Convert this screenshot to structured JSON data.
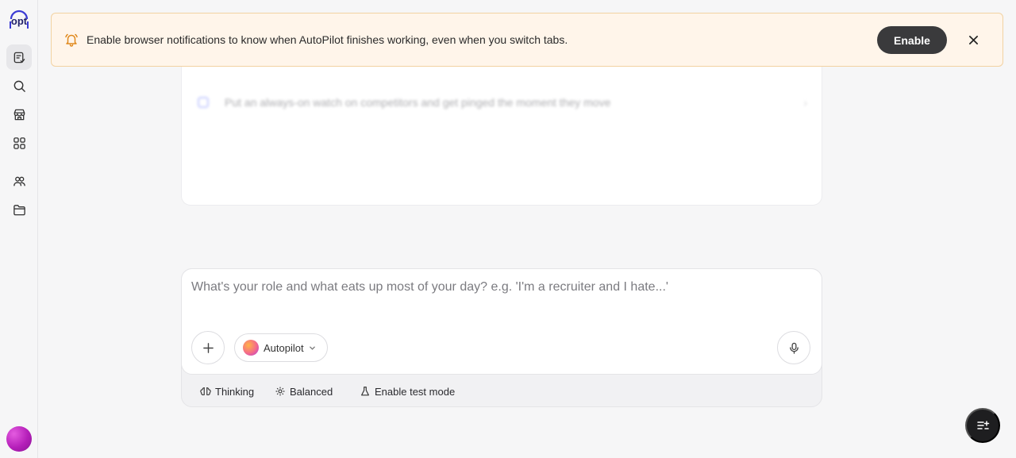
{
  "sidebar": {
    "logo_text": "opt",
    "items": [
      {
        "icon": "tasks-icon",
        "active": true
      },
      {
        "icon": "search-icon",
        "active": false
      },
      {
        "icon": "store-icon",
        "active": false
      },
      {
        "icon": "apps-icon",
        "active": false
      },
      {
        "icon": "team-icon",
        "active": false
      },
      {
        "icon": "folder-icon",
        "active": false
      }
    ],
    "avatar_icon": "user-avatar"
  },
  "banner": {
    "icon": "bell-icon",
    "text": "Enable browser notifications to know when AutoPilot finishes working, even when you switch tabs.",
    "enable_label": "Enable",
    "close_icon": "close-icon"
  },
  "suggestion": {
    "text": "Put an always-on watch on competitors and get pinged the moment they move",
    "arrow": "›"
  },
  "composer": {
    "placeholder": "What's your role and what eats up most of your day? e.g. 'I'm a recruiter and I hate...'",
    "value": "",
    "model_label": "Autopilot",
    "options": {
      "thinking": "Thinking",
      "balanced": "Balanced",
      "test_mode": "Enable test mode"
    }
  },
  "colors": {
    "accent_dark": "#3a3a3c",
    "banner_bg": "#fff5ea",
    "banner_border": "#f2d2a2",
    "bell": "#e0891d"
  }
}
